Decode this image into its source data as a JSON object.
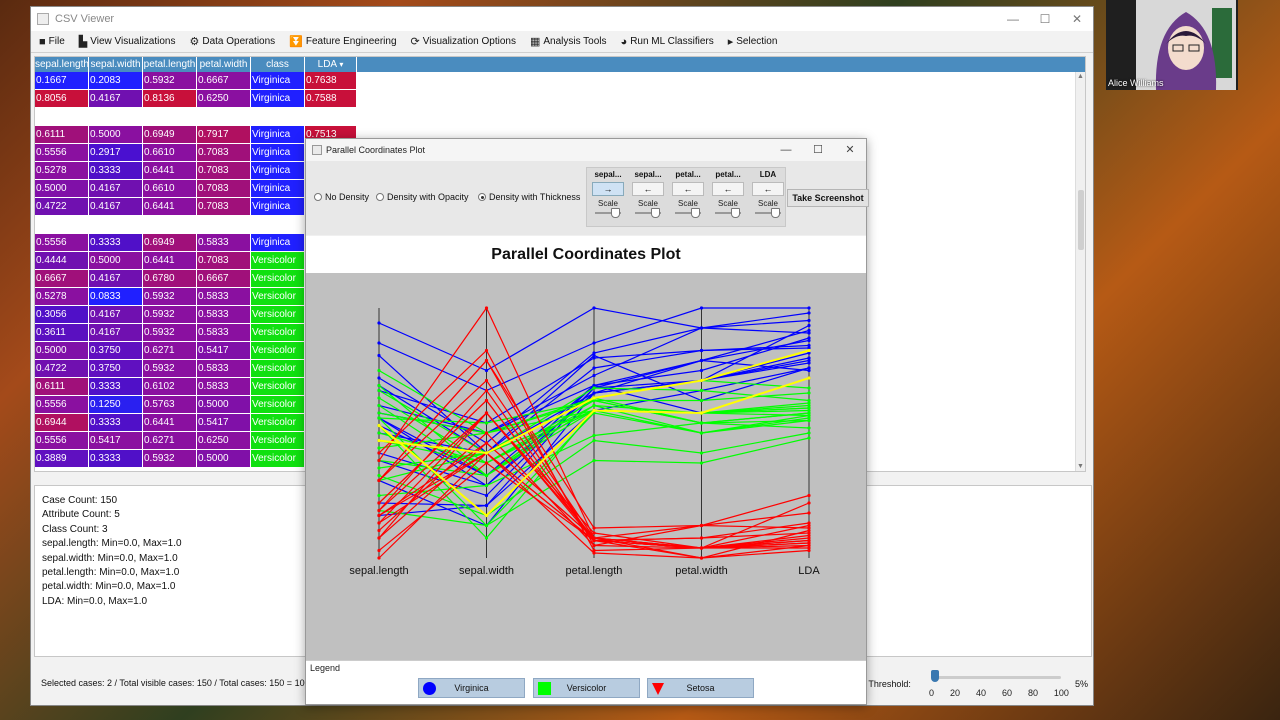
{
  "main_window": {
    "title": "CSV Viewer",
    "controls": {
      "minimize": "—",
      "maximize": "☐",
      "close": "✕"
    }
  },
  "menu": [
    {
      "icon": "folder-icon",
      "glyph": "■",
      "label": "File"
    },
    {
      "icon": "bar-chart-icon",
      "glyph": "▙",
      "label": "View Visualizations"
    },
    {
      "icon": "settings-icon",
      "glyph": "⚙",
      "label": "Data Operations"
    },
    {
      "icon": "funnel-icon",
      "glyph": "⏬",
      "label": "Feature Engineering"
    },
    {
      "icon": "refresh-icon",
      "glyph": "⟳",
      "label": "Visualization Options"
    },
    {
      "icon": "grid-icon",
      "glyph": "▦",
      "label": "Analysis Tools"
    },
    {
      "icon": "brain-icon",
      "glyph": "◕",
      "label": "Run ML Classifiers"
    },
    {
      "icon": "cursor-icon",
      "glyph": "▸",
      "label": "Selection"
    }
  ],
  "table": {
    "headers": [
      "sepal.length",
      "sepal.width",
      "petal.length",
      "petal.width",
      "class",
      "LDA"
    ],
    "sort_arrow": "▾",
    "rows": [
      {
        "cells": [
          "0.1667",
          "0.2083",
          "0.5932",
          "0.6667",
          "Virginica",
          "0.7638"
        ],
        "colors": [
          "#2020ff",
          "#2020ff",
          "#8a10a0",
          "#8a10a0",
          "#2020ff",
          "#c8103a"
        ]
      },
      {
        "cells": [
          "0.8056",
          "0.4167",
          "0.8136",
          "0.6250",
          "Virginica",
          "0.7588"
        ],
        "colors": [
          "#c8103a",
          "#7010b0",
          "#c8103a",
          "#8a10a0",
          "#2020ff",
          "#c8103a"
        ]
      },
      {
        "cells": null
      },
      {
        "cells": [
          "0.6111",
          "0.5000",
          "0.6949",
          "0.7917",
          "Virginica",
          "0.7513"
        ],
        "colors": [
          "#a0107a",
          "#8a10a0",
          "#a0107a",
          "#b01060",
          "#2020ff",
          "#c8103a"
        ]
      },
      {
        "cells": [
          "0.5556",
          "0.2917",
          "0.6610",
          "0.7083",
          "Virginica",
          ""
        ],
        "colors": [
          "#8a10a0",
          "#4a10d0",
          "#8a10a0",
          "#a0107a",
          "#2020ff",
          "#c8103a"
        ]
      },
      {
        "cells": [
          "0.5278",
          "0.3333",
          "0.6441",
          "0.7083",
          "Virginica",
          ""
        ],
        "colors": [
          "#8a10a0",
          "#5010c8",
          "#8a10a0",
          "#a0107a",
          "#2020ff",
          "#c8103a"
        ]
      },
      {
        "cells": [
          "0.5000",
          "0.4167",
          "0.6610",
          "0.7083",
          "Virginica",
          ""
        ],
        "colors": [
          "#8010a8",
          "#7010b0",
          "#8a10a0",
          "#a0107a",
          "#2020ff",
          "#c8103a"
        ]
      },
      {
        "cells": [
          "0.4722",
          "0.4167",
          "0.6441",
          "0.7083",
          "Virginica",
          ""
        ],
        "colors": [
          "#7010b0",
          "#7010b0",
          "#8a10a0",
          "#a0107a",
          "#2020ff",
          "#c8103a"
        ]
      },
      {
        "cells": null
      },
      {
        "cells": [
          "0.5556",
          "0.3333",
          "0.6949",
          "0.5833",
          "Virginica",
          ""
        ],
        "colors": [
          "#8a10a0",
          "#5010c8",
          "#a0107a",
          "#8a10a0",
          "#2020ff",
          "#c8103a"
        ]
      },
      {
        "cells": [
          "0.4444",
          "0.5000",
          "0.6441",
          "0.7083",
          "Versicolor",
          ""
        ],
        "colors": [
          "#7010b0",
          "#8a10a0",
          "#8a10a0",
          "#a0107a",
          "#10e010",
          "#c8103a"
        ]
      },
      {
        "cells": [
          "0.6667",
          "0.4167",
          "0.6780",
          "0.6667",
          "Versicolor",
          ""
        ],
        "colors": [
          "#a0107a",
          "#7010b0",
          "#a0107a",
          "#a0107a",
          "#10e010",
          "#c8103a"
        ]
      },
      {
        "cells": [
          "0.5278",
          "0.0833",
          "0.5932",
          "0.5833",
          "Versicolor",
          ""
        ],
        "colors": [
          "#8a10a0",
          "#2020ff",
          "#8a10a0",
          "#8a10a0",
          "#10e010",
          "#c8103a"
        ]
      },
      {
        "cells": [
          "0.3056",
          "0.4167",
          "0.5932",
          "0.5833",
          "Versicolor",
          ""
        ],
        "colors": [
          "#5010c8",
          "#7010b0",
          "#8a10a0",
          "#8a10a0",
          "#10e010",
          "#c8103a"
        ]
      },
      {
        "cells": [
          "0.3611",
          "0.4167",
          "0.5932",
          "0.5833",
          "Versicolor",
          ""
        ],
        "colors": [
          "#5a10c0",
          "#7010b0",
          "#8a10a0",
          "#8a10a0",
          "#10e010",
          "#c8103a"
        ]
      },
      {
        "cells": [
          "0.5000",
          "0.3750",
          "0.6271",
          "0.5417",
          "Versicolor",
          ""
        ],
        "colors": [
          "#8010a8",
          "#6010c0",
          "#8a10a0",
          "#8010a8",
          "#10e010",
          "#c8103a"
        ]
      },
      {
        "cells": [
          "0.4722",
          "0.3750",
          "0.5932",
          "0.5833",
          "Versicolor",
          ""
        ],
        "colors": [
          "#7010b0",
          "#6010c0",
          "#8a10a0",
          "#8a10a0",
          "#10e010",
          "#c8103a"
        ]
      },
      {
        "cells": [
          "0.6111",
          "0.3333",
          "0.6102",
          "0.5833",
          "Versicolor",
          ""
        ],
        "colors": [
          "#a0107a",
          "#5010c8",
          "#8a10a0",
          "#8a10a0",
          "#10e010",
          "#c8103a"
        ]
      },
      {
        "cells": [
          "0.5556",
          "0.1250",
          "0.5763",
          "0.5000",
          "Versicolor",
          ""
        ],
        "colors": [
          "#8a10a0",
          "#2a20f0",
          "#8a10a0",
          "#8010a8",
          "#10e010",
          "#c8103a"
        ]
      },
      {
        "cells": [
          "0.6944",
          "0.3333",
          "0.6441",
          "0.5417",
          "Versicolor",
          ""
        ],
        "colors": [
          "#b01060",
          "#5010c8",
          "#8a10a0",
          "#8010a8",
          "#10e010",
          "#c8103a"
        ]
      },
      {
        "cells": [
          "0.5556",
          "0.5417",
          "0.6271",
          "0.6250",
          "Versicolor",
          ""
        ],
        "colors": [
          "#8a10a0",
          "#8a10a0",
          "#8a10a0",
          "#8a10a0",
          "#10e010",
          "#c8103a"
        ]
      },
      {
        "cells": [
          "0.3889",
          "0.3333",
          "0.5932",
          "0.5000",
          "Versicolor",
          ""
        ],
        "colors": [
          "#6010c0",
          "#5010c8",
          "#8a10a0",
          "#8010a8",
          "#10e010",
          "#c8103a"
        ]
      }
    ]
  },
  "info": [
    "Case Count: 150",
    "Attribute Count: 5",
    "Class Count: 3",
    "sepal.length: Min=0.0, Max=1.0",
    "sepal.width: Min=0.0, Max=1.0",
    "petal.length: Min=0.0, Max=1.0",
    "petal.width: Min=0.0, Max=1.0",
    "LDA: Min=0.0, Max=1.0"
  ],
  "status": "Selected cases: 2 / Total visible cases: 150 / Total cases: 150 = 100.00%",
  "threshold": {
    "label": "e Threshold:",
    "ticks": [
      "0",
      "20",
      "40",
      "60",
      "80",
      "100"
    ],
    "value_label": "5%",
    "value": 0.05
  },
  "pc_window": {
    "title": "Parallel Coordinates Plot",
    "controls": {
      "minimize": "—",
      "maximize": "☐",
      "close": "✕"
    },
    "density_options": [
      {
        "label": "No Density",
        "selected": false
      },
      {
        "label": "Density with Opacity",
        "selected": false
      },
      {
        "label": "Density with Thickness",
        "selected": true
      }
    ],
    "attr_controls": [
      {
        "name": "sepal...",
        "arrow": "→",
        "active": true,
        "scale": "Scale"
      },
      {
        "name": "sepal...",
        "arrow": "←",
        "active": false,
        "scale": "Scale"
      },
      {
        "name": "petal...",
        "arrow": "←",
        "active": false,
        "scale": "Scale"
      },
      {
        "name": "petal...",
        "arrow": "←",
        "active": false,
        "scale": "Scale"
      },
      {
        "name": "LDA",
        "arrow": "←",
        "active": false,
        "scale": "Scale"
      }
    ],
    "screenshot_label": "Take Screenshot",
    "plot_title": "Parallel Coordinates Plot",
    "legend_title": "Legend",
    "legend": [
      {
        "label": "Virginica",
        "color": "#0000ff",
        "shape": "circle"
      },
      {
        "label": "Versicolor",
        "color": "#00ff00",
        "shape": "square"
      },
      {
        "label": "Setosa",
        "color": "#ff0000",
        "shape": "triangle"
      }
    ]
  },
  "chart_data": {
    "type": "parallel-coordinates",
    "axes": [
      "sepal.length",
      "sepal.width",
      "petal.length",
      "petal.width",
      "LDA"
    ],
    "ylim": [
      0,
      1
    ],
    "series": [
      {
        "name": "Virginica",
        "color": "#0000ff",
        "lines": [
          [
            0.17,
            0.21,
            0.59,
            0.67,
            0.76
          ],
          [
            0.81,
            0.42,
            0.81,
            0.63,
            0.76
          ],
          [
            0.61,
            0.5,
            0.69,
            0.79,
            0.75
          ],
          [
            0.56,
            0.29,
            0.66,
            0.71,
            0.8
          ],
          [
            0.53,
            0.33,
            0.64,
            0.71,
            0.78
          ],
          [
            0.5,
            0.42,
            0.66,
            0.71,
            0.82
          ],
          [
            0.47,
            0.42,
            0.64,
            0.71,
            0.79
          ],
          [
            0.56,
            0.33,
            0.69,
            0.58,
            0.72
          ],
          [
            0.94,
            0.75,
            1.0,
            0.92,
            0.95
          ],
          [
            0.72,
            0.46,
            0.82,
            0.92,
            0.9
          ],
          [
            0.67,
            0.54,
            0.8,
            0.83,
            0.85
          ],
          [
            0.39,
            0.25,
            0.68,
            0.79,
            0.87
          ],
          [
            0.22,
            0.21,
            0.68,
            0.71,
            0.93
          ],
          [
            0.58,
            0.5,
            0.73,
            0.92,
            0.98
          ],
          [
            0.86,
            0.67,
            0.86,
            1.0,
            1.0
          ],
          [
            0.69,
            0.42,
            0.76,
            0.83,
            0.84
          ],
          [
            0.42,
            0.29,
            0.69,
            0.75,
            0.88
          ],
          [
            0.31,
            0.13,
            0.66,
            0.79,
            0.91
          ]
        ]
      },
      {
        "name": "Versicolor",
        "color": "#00ff00",
        "lines": [
          [
            0.44,
            0.5,
            0.64,
            0.71,
            0.68
          ],
          [
            0.67,
            0.42,
            0.68,
            0.67,
            0.63
          ],
          [
            0.53,
            0.08,
            0.59,
            0.58,
            0.62
          ],
          [
            0.31,
            0.42,
            0.59,
            0.58,
            0.6
          ],
          [
            0.36,
            0.42,
            0.59,
            0.58,
            0.61
          ],
          [
            0.5,
            0.38,
            0.63,
            0.54,
            0.58
          ],
          [
            0.47,
            0.38,
            0.59,
            0.58,
            0.6
          ],
          [
            0.61,
            0.33,
            0.61,
            0.58,
            0.57
          ],
          [
            0.56,
            0.13,
            0.58,
            0.5,
            0.55
          ],
          [
            0.69,
            0.33,
            0.64,
            0.54,
            0.52
          ],
          [
            0.56,
            0.54,
            0.63,
            0.63,
            0.66
          ],
          [
            0.39,
            0.33,
            0.59,
            0.5,
            0.56
          ],
          [
            0.19,
            0.13,
            0.39,
            0.38,
            0.48
          ],
          [
            0.75,
            0.5,
            0.63,
            0.54,
            0.55
          ],
          [
            0.58,
            0.5,
            0.59,
            0.58,
            0.59
          ],
          [
            0.25,
            0.29,
            0.49,
            0.54,
            0.58
          ],
          [
            0.64,
            0.38,
            0.61,
            0.5,
            0.57
          ],
          [
            0.33,
            0.17,
            0.47,
            0.42,
            0.5
          ]
        ]
      },
      {
        "name": "Setosa",
        "color": "#ff0000",
        "lines": [
          [
            0.22,
            0.63,
            0.07,
            0.04,
            0.07
          ],
          [
            0.17,
            0.42,
            0.07,
            0.04,
            0.06
          ],
          [
            0.11,
            0.5,
            0.05,
            0.04,
            0.08
          ],
          [
            0.08,
            0.46,
            0.08,
            0.04,
            0.05
          ],
          [
            0.19,
            0.67,
            0.07,
            0.04,
            0.09
          ],
          [
            0.31,
            0.79,
            0.12,
            0.13,
            0.12
          ],
          [
            0.08,
            0.58,
            0.07,
            0.08,
            0.1
          ],
          [
            0.19,
            0.58,
            0.08,
            0.04,
            0.07
          ],
          [
            0.03,
            0.38,
            0.07,
            0.04,
            0.04
          ],
          [
            0.17,
            0.46,
            0.08,
            0.0,
            0.11
          ],
          [
            0.31,
            0.71,
            0.08,
            0.04,
            0.13
          ],
          [
            0.14,
            0.58,
            0.1,
            0.04,
            0.06
          ],
          [
            0.14,
            0.42,
            0.07,
            0.0,
            0.05
          ],
          [
            0.0,
            0.42,
            0.02,
            0.0,
            0.03
          ],
          [
            0.42,
            0.83,
            0.03,
            0.04,
            0.22
          ],
          [
            0.39,
            1.0,
            0.08,
            0.13,
            0.25
          ],
          [
            0.31,
            0.79,
            0.05,
            0.13,
            0.18
          ],
          [
            0.22,
            0.63,
            0.07,
            0.08,
            0.14
          ]
        ]
      },
      {
        "name": "Selected",
        "color": "#ffff00",
        "lines": [
          [
            0.47,
            0.42,
            0.64,
            0.71,
            0.83
          ],
          [
            0.53,
            0.17,
            0.59,
            0.58,
            0.72
          ]
        ]
      }
    ]
  },
  "webcam": {
    "name": "Alice Williams"
  }
}
